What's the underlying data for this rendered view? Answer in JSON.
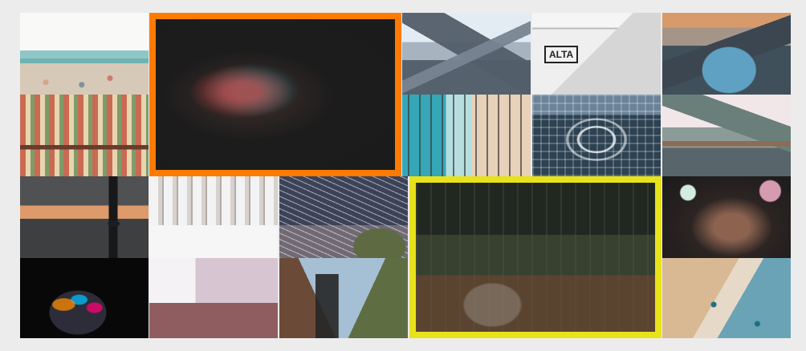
{
  "gallery": {
    "tiles": [
      {
        "name": "beach-photo-top",
        "style": "p-beach-top"
      },
      {
        "name": "resort-photo",
        "style": "p-resort"
      },
      {
        "name": "portrait-photo-selected",
        "style": "p-portrait",
        "text": "",
        "selection_color": "#ff7a00"
      },
      {
        "name": "mountain-photo",
        "style": "p-mountain"
      },
      {
        "name": "alta-building-photo",
        "style": "p-alta",
        "text": "ALTA"
      },
      {
        "name": "lake-photo",
        "style": "p-lake"
      },
      {
        "name": "aerial-beach-photo",
        "style": "p-aerial"
      },
      {
        "name": "dome-photo",
        "style": "p-dome"
      },
      {
        "name": "coast-photo",
        "style": "p-coast"
      },
      {
        "name": "silhouette-photo",
        "style": "p-silhouette"
      },
      {
        "name": "street-photo",
        "style": "p-street"
      },
      {
        "name": "star-trails-photo",
        "style": "p-stars"
      },
      {
        "name": "forest-photo-selected",
        "style": "p-forest",
        "selection_color": "#e8e21a"
      },
      {
        "name": "flower-crown-photo",
        "style": "p-flowers"
      },
      {
        "name": "painted-portrait-photo",
        "style": "p-painted"
      },
      {
        "name": "patio-photo",
        "style": "p-patio"
      },
      {
        "name": "eiffel-tower-photo",
        "style": "p-eiffel"
      },
      {
        "name": "beach-photo-bottom",
        "style": "p-beach-bottom"
      }
    ]
  }
}
